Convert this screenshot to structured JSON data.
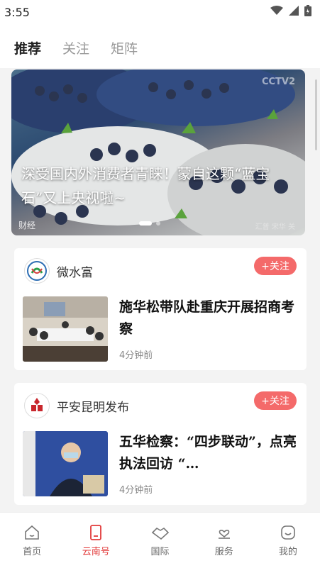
{
  "status_bar": {
    "time": "3:55"
  },
  "top_tabs": [
    {
      "label": "推荐"
    },
    {
      "label": "关注"
    },
    {
      "label": "矩阵"
    }
  ],
  "hero": {
    "title": "深受国内外消费者青睐！蒙自这颗“蓝宝石”又上央视啦~",
    "tag": "财经",
    "credit": "汇普 宋华 关",
    "watermark": "CCTV2"
  },
  "feed": [
    {
      "source": "微水富",
      "follow_label": "+关注",
      "headline": "施华松带队赴重庆开展招商考察",
      "time": "4分钟前"
    },
    {
      "source": "平安昆明发布",
      "follow_label": "+关注",
      "headline": "五华检察：“四步联动”，点亮执法回访 “…",
      "time": "4分钟前"
    }
  ],
  "bottom_nav": [
    {
      "label": "首页",
      "icon": "home-icon"
    },
    {
      "label": "云南号",
      "icon": "phone-icon",
      "active": true
    },
    {
      "label": "国际",
      "icon": "handshake-icon"
    },
    {
      "label": "服务",
      "icon": "heart-hand-icon"
    },
    {
      "label": "我的",
      "icon": "face-icon"
    }
  ],
  "colors": {
    "accent": "#e23a3a",
    "follow_bg": "#f46a6a"
  }
}
